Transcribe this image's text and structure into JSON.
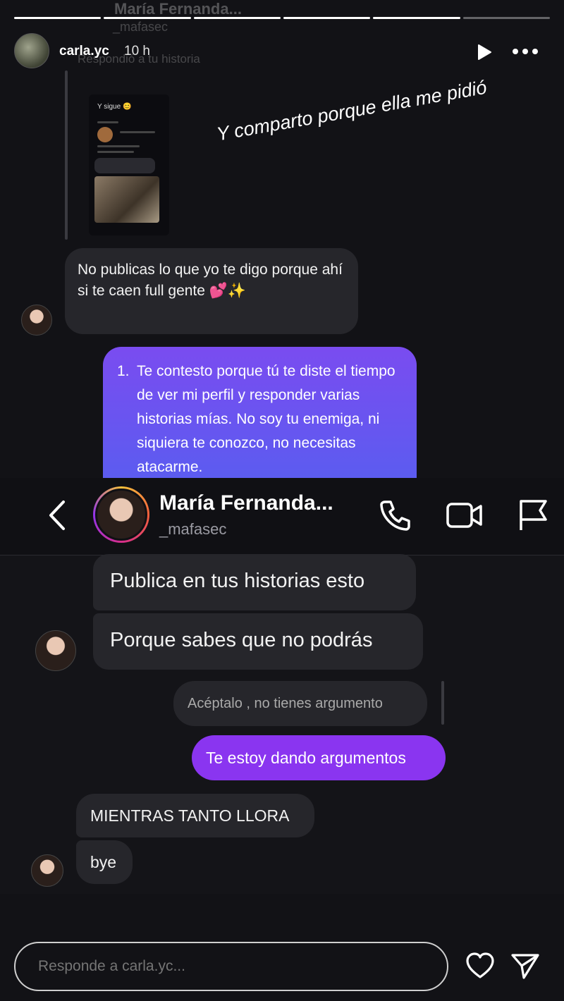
{
  "ghost_header": {
    "name": "María Fernanda...",
    "username": "_mafasec",
    "reply_note": "Respondió a tu historia"
  },
  "story": {
    "username": "carla.yc",
    "time": "10 h",
    "caption": "Y comparto porque ella me pidió"
  },
  "thumbnail": {
    "title": "Y sigue 😊"
  },
  "messages_top": {
    "incoming": "No publicas lo que yo te digo porque ahí si te caen full gente 💕✨",
    "outgoing_number": "1.",
    "outgoing": "Te contesto porque tú te diste el tiempo de ver mi perfil y responder varias historias mías. No soy tu enemiga, ni siquiera te conozco, no necesitas atacarme."
  },
  "dm_header": {
    "name": "María Fernanda...",
    "username": "_mafasec"
  },
  "messages_bottom": {
    "m1": "Publica en tus historias esto",
    "m2": "Porque sabes que no podrás",
    "m3": "Acéptalo , no tienes argumento",
    "m4": "Te estoy dando argumentos",
    "m5": "MIENTRAS TANTO LLORA",
    "m6": "bye"
  },
  "reply": {
    "placeholder": "Responde a carla.yc..."
  },
  "colors": {
    "outgoing_gradient_top": "#7a4cf0",
    "outgoing_gradient_bottom": "#5b5cf0",
    "outgoing_bubble": "#8a35f0",
    "incoming_bubble": "#26262b"
  }
}
